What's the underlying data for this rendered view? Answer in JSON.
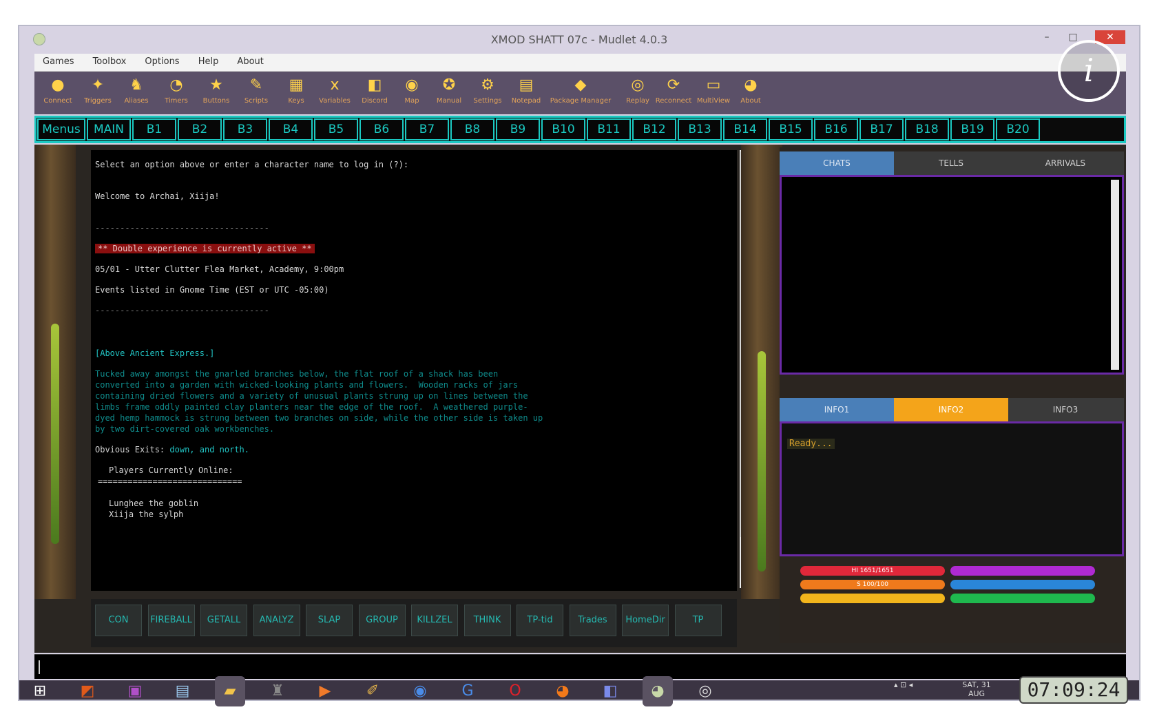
{
  "window": {
    "title": "XMOD SHATT 07c - Mudlet 4.0.3",
    "controls": {
      "minimize": "–",
      "maximize": "□",
      "close": "✕"
    }
  },
  "menubar": [
    "Games",
    "Toolbox",
    "Options",
    "Help",
    "About"
  ],
  "toolbar": [
    {
      "label": "Connect",
      "icon": "connect-icon",
      "glyph": "●"
    },
    {
      "label": "Triggers",
      "icon": "triggers-icon",
      "glyph": "✦"
    },
    {
      "label": "Aliases",
      "icon": "aliases-icon",
      "glyph": "♞"
    },
    {
      "label": "Timers",
      "icon": "timers-icon",
      "glyph": "◔"
    },
    {
      "label": "Buttons",
      "icon": "buttons-icon",
      "glyph": "★"
    },
    {
      "label": "Scripts",
      "icon": "scripts-icon",
      "glyph": "✎"
    },
    {
      "label": "Keys",
      "icon": "keys-icon",
      "glyph": "▦"
    },
    {
      "label": "Variables",
      "icon": "variables-icon",
      "glyph": "x"
    },
    {
      "label": "Discord",
      "icon": "discord-icon",
      "glyph": "◧"
    },
    {
      "label": "Map",
      "icon": "map-icon",
      "glyph": "◉"
    },
    {
      "label": "Manual",
      "icon": "manual-icon",
      "glyph": "✪"
    },
    {
      "label": "Settings",
      "icon": "settings-icon",
      "glyph": "⚙"
    },
    {
      "label": "Notepad",
      "icon": "notepad-icon",
      "glyph": "▤"
    },
    {
      "label": "Package Manager",
      "icon": "package-manager-icon",
      "glyph": "◆"
    },
    {
      "label": "Replay",
      "icon": "replay-icon",
      "glyph": "◎"
    },
    {
      "label": "Reconnect",
      "icon": "reconnect-icon",
      "glyph": "⟳"
    },
    {
      "label": "MultiView",
      "icon": "multiview-icon",
      "glyph": "▭"
    },
    {
      "label": "About",
      "icon": "about-icon",
      "glyph": "◕"
    }
  ],
  "buttonrow": [
    "Menus",
    "MAIN",
    "B1",
    "B2",
    "B3",
    "B4",
    "B5",
    "B6",
    "B7",
    "B8",
    "B9",
    "B10",
    "B11",
    "B12",
    "B13",
    "B14",
    "B15",
    "B16",
    "B17",
    "B18",
    "B19",
    "B20"
  ],
  "console": {
    "lines": [
      "Select an option above or enter a character name to log in (?):",
      "Welcome to Archai, Xiija!",
      "-----------------------------------",
      "** Double experience is currently active **",
      "05/01 - Utter Clutter Flea Market, Academy, 9:00pm",
      "Events listed in Gnome Time (EST or UTC -05:00)",
      "-----------------------------------",
      "[Above Ancient Express.]",
      "Tucked away amongst the gnarled branches below, the flat roof of a shack has been",
      "converted into a garden with wicked-looking plants and flowers.  Wooden racks of jars",
      "containing dried flowers and a variety of unusual plants strung up on lines between the",
      "limbs frame oddly painted clay planters near the edge of the roof.  A weathered purple-",
      "dyed hemp hammock is strung between two branches on side, while the other side is taken up",
      "by two dirt-covered oak workbenches.",
      "Obvious Exits:",
      "down, and north.",
      "Players Currently Online:",
      "=============================",
      "Lunghee the goblin",
      "Xiija the sylph"
    ]
  },
  "commands": [
    "CON",
    "FIREBALL",
    "GETALL",
    "ANALYZ",
    "SLAP",
    "GROUP",
    "KILLZEL",
    "THINK",
    "TP-tid",
    "Trades",
    "HomeDir",
    "TP"
  ],
  "sidepanel": {
    "top_tabs": [
      "CHATS",
      "TELLS",
      "ARRIVALS"
    ],
    "bottom_tabs": [
      "INFO1",
      "INFO2",
      "INFO3"
    ],
    "ready_text": "Ready...",
    "gauges": [
      {
        "label": "HI 1651/1651",
        "color": "#e0283a"
      },
      {
        "label": "",
        "color": "#b02ad2"
      },
      {
        "label": "S 100/100",
        "color": "#ef7a1c"
      },
      {
        "label": "",
        "color": "#2a86d8"
      },
      {
        "label": "",
        "color": "#f2b51c"
      },
      {
        "label": "",
        "color": "#1fb84e"
      }
    ]
  },
  "taskbar": {
    "apps": [
      {
        "name": "start-icon",
        "glyph": "⊞",
        "color": "#ffffff"
      },
      {
        "name": "paint-icon",
        "glyph": "◩",
        "color": "#e05a1a"
      },
      {
        "name": "chat-app-icon",
        "glyph": "▣",
        "color": "#b050c8"
      },
      {
        "name": "notepad-app-icon",
        "glyph": "▤",
        "color": "#9ac8ee"
      },
      {
        "name": "file-explorer-icon",
        "glyph": "▰",
        "color": "#f2c44a"
      },
      {
        "name": "game-app-icon",
        "glyph": "♜",
        "color": "#888"
      },
      {
        "name": "media-player-icon",
        "glyph": "▶",
        "color": "#f07a2a"
      },
      {
        "name": "tools-icon",
        "glyph": "✐",
        "color": "#e2b24a"
      },
      {
        "name": "chrome-icon",
        "glyph": "◉",
        "color": "#4a8ce8"
      },
      {
        "name": "google-icon",
        "glyph": "G",
        "color": "#4a8ce8"
      },
      {
        "name": "opera-icon",
        "glyph": "O",
        "color": "#e0202a"
      },
      {
        "name": "firefox-icon",
        "glyph": "◕",
        "color": "#f47a1a"
      },
      {
        "name": "discord-app-icon",
        "glyph": "◧",
        "color": "#7a8aea"
      },
      {
        "name": "mudlet-icon",
        "glyph": "◕",
        "color": "#c8d8a8"
      },
      {
        "name": "obs-icon",
        "glyph": "◎",
        "color": "#dddddd"
      }
    ],
    "tray_date": "SAT, 31 AUG",
    "clock": "07:09:24"
  },
  "overlay": {
    "info_glyph": "i"
  }
}
